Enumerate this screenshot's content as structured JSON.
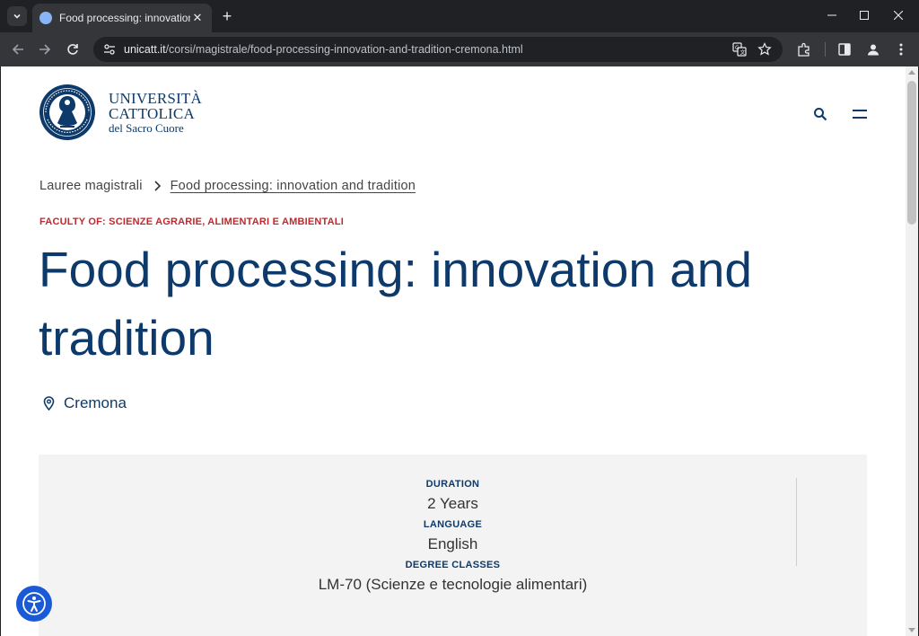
{
  "browser": {
    "tab_title": "Food processing: innovation and tradition",
    "url_host": "unicatt.it",
    "url_path": "/corsi/magistrale/food-processing-innovation-and-tradition-cremona.html",
    "tab_close": "✕",
    "new_tab": "+"
  },
  "logo": {
    "line1": "UNIVERSITÀ",
    "line2": "CATTOLICA",
    "line3": "del Sacro Cuore"
  },
  "breadcrumb": {
    "parent": "Lauree magistrali",
    "current": "Food processing: innovation and tradition"
  },
  "faculty": "FACULTY OF: SCIENZE AGRARIE, ALIMENTARI E AMBIENTALI",
  "title": "Food processing: innovation and tradition",
  "location": "Cremona",
  "info": {
    "duration_label": "DURATION",
    "duration_value": "2 Years",
    "language_label": "LANGUAGE",
    "language_value": "English",
    "degree_label": "DEGREE CLASSES",
    "degree_value": "LM-70 (Scienze e tecnologie alimentari)"
  },
  "colors": {
    "brand_blue": "#0d3a6b",
    "faculty_red": "#c1272d",
    "accessibility_blue": "#1a5ad7"
  },
  "icons": [
    "tab-list-icon",
    "close-icon",
    "plus-icon",
    "minimize-icon",
    "maximize-icon",
    "back-icon",
    "forward-icon",
    "reload-icon",
    "site-info-icon",
    "translate-icon",
    "bookmark-star-icon",
    "extensions-icon",
    "side-panel-icon",
    "profile-icon",
    "kebab-menu-icon",
    "search-icon",
    "hamburger-menu-icon",
    "chevron-right-icon",
    "location-pin-icon",
    "accessibility-icon"
  ]
}
